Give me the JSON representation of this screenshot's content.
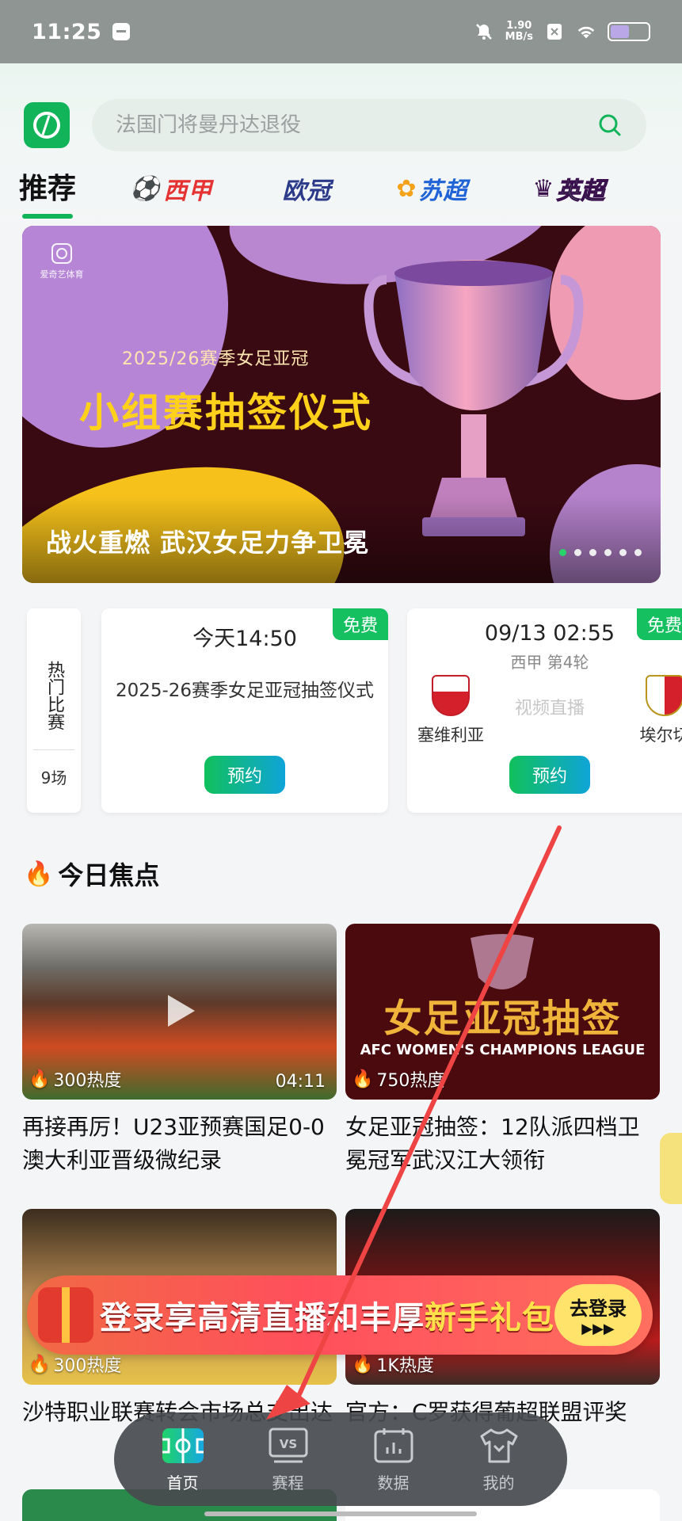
{
  "status_bar": {
    "time": "11:25",
    "speed_value": "1.90",
    "speed_unit": "MB/s",
    "battery_level": 0.5
  },
  "search": {
    "placeholder": "法国门将曼丹达退役"
  },
  "tabs": [
    {
      "label": "推荐",
      "active": true
    },
    {
      "label": "西甲",
      "active": false
    },
    {
      "label": "欧冠",
      "active": false
    },
    {
      "label": "苏超",
      "active": false
    },
    {
      "label": "英超",
      "active": false
    }
  ],
  "banner": {
    "brand": "爱奇艺体育",
    "season": "2025/26赛季女足亚冠",
    "title": "小组赛抽签仪式",
    "caption": "战火重燃 武汉女足力争卫冕",
    "slide_count": 6,
    "active_slide": 1
  },
  "hot_matches": {
    "label": "热门比赛",
    "count": "9场",
    "matches": [
      {
        "badge": "免费",
        "time": "今天14:50",
        "title": "2025-26赛季女足亚冠抽签仪式",
        "button": "预约"
      },
      {
        "badge": "免费",
        "time": "09/13 02:55",
        "round": "西甲 第4轮",
        "home": "塞维利亚",
        "away": "埃尔切",
        "live": "视频直播",
        "button": "预约"
      }
    ]
  },
  "focus": {
    "title": "今日焦点",
    "cards": [
      {
        "heat": "300热度",
        "duration": "04:11",
        "title": "再接再厉！U23亚预赛国足0-0澳大利亚晋级微纪录"
      },
      {
        "heat": "750热度",
        "image_text": "女足亚冠抽签",
        "image_sub": "AFC WOMEN'S CHAMPIONS LEAGUE",
        "title": "女足亚冠抽签：12队派四档卫冕冠军武汉江大领衔"
      },
      {
        "heat": "300热度",
        "title": "沙特职业联赛转会市场总支出达"
      },
      {
        "heat": "1K热度",
        "title": "官方：C罗获得葡超联盟评奖"
      }
    ]
  },
  "promo": {
    "text_main": "登录享高清直播和丰厚",
    "text_highlight": "新手礼包",
    "button_line1": "去登录",
    "button_line2": "▶▶▶"
  },
  "bottom_nav": [
    {
      "label": "首页",
      "icon": "home-icon",
      "active": true
    },
    {
      "label": "赛程",
      "icon": "schedule-vs-icon",
      "active": false
    },
    {
      "label": "数据",
      "icon": "data-chart-icon",
      "active": false
    },
    {
      "label": "我的",
      "icon": "profile-jersey-icon",
      "active": false
    }
  ],
  "colors": {
    "accent": "#12b45a",
    "free_badge": "#14c05f",
    "promo": "#ff4f5c",
    "arrow": "#ee4444"
  }
}
